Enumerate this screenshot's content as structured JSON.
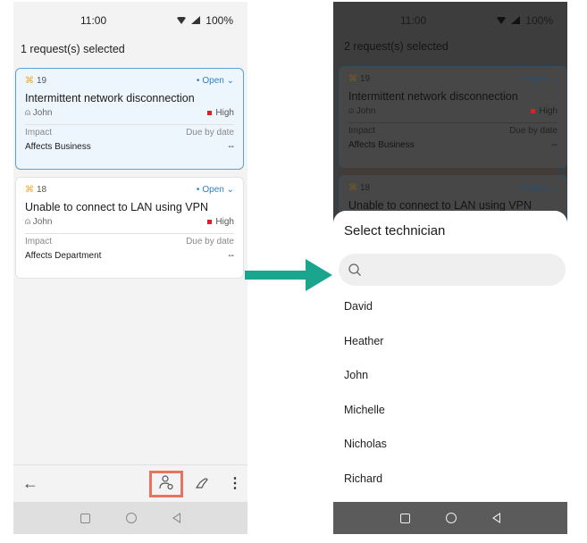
{
  "left_screen": {
    "status": {
      "time": "11:00",
      "battery": "100%"
    },
    "selection_title": "1 request(s) selected",
    "requests": [
      {
        "id": "19",
        "state": "Open",
        "subject": "Intermittent network disconnection",
        "requester": "John",
        "priority": "High",
        "impact_label": "Impact",
        "impact": "Affects Business",
        "due_label": "Due by date",
        "due": "--"
      },
      {
        "id": "18",
        "state": "Open",
        "subject": "Unable to connect to LAN using VPN",
        "requester": "John",
        "priority": "High",
        "impact_label": "Impact",
        "impact": "Affects Department",
        "due_label": "Due by date",
        "due": "--"
      }
    ],
    "toolbar": {
      "back": "←",
      "more": "⋮"
    },
    "highlight_color": "#e8735f"
  },
  "right_screen": {
    "status": {
      "time": "11:00",
      "battery": "100%"
    },
    "selection_title": "2 request(s) selected",
    "requests": [
      {
        "id": "19",
        "state": "Open",
        "subject": "Intermittent network disconnection",
        "requester": "John",
        "priority": "High",
        "impact_label": "Impact",
        "impact": "Affects Business",
        "due_label": "Due by date",
        "due": "--"
      },
      {
        "id": "18",
        "state": "Open",
        "subject": "Unable to connect to LAN using VPN"
      }
    ],
    "sheet": {
      "title": "Select technician",
      "search_placeholder": "",
      "technicians": [
        "David",
        "Heather",
        "John",
        "Michelle",
        "Nicholas",
        "Richard"
      ]
    }
  },
  "arrow_color": "#1aa58f"
}
